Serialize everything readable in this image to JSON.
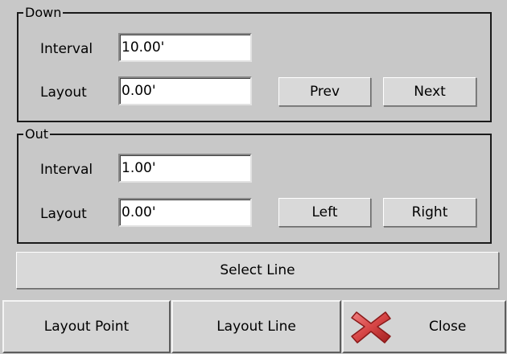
{
  "down": {
    "title": "Down",
    "interval_label": "Interval",
    "interval_value": "10.00'",
    "layout_label": "Layout",
    "layout_value": "0.00'",
    "prev_label": "Prev",
    "next_label": "Next"
  },
  "out": {
    "title": "Out",
    "interval_label": "Interval",
    "interval_value": "1.00'",
    "layout_label": "Layout",
    "layout_value": "0.00'",
    "left_label": "Left",
    "right_label": "Right"
  },
  "select_line_label": "Select Line",
  "bottom": {
    "layout_point_label": "Layout Point",
    "layout_line_label": "Layout Line",
    "close_label": "Close",
    "close_icon": "close-icon",
    "close_icon_color": "#d64545"
  }
}
